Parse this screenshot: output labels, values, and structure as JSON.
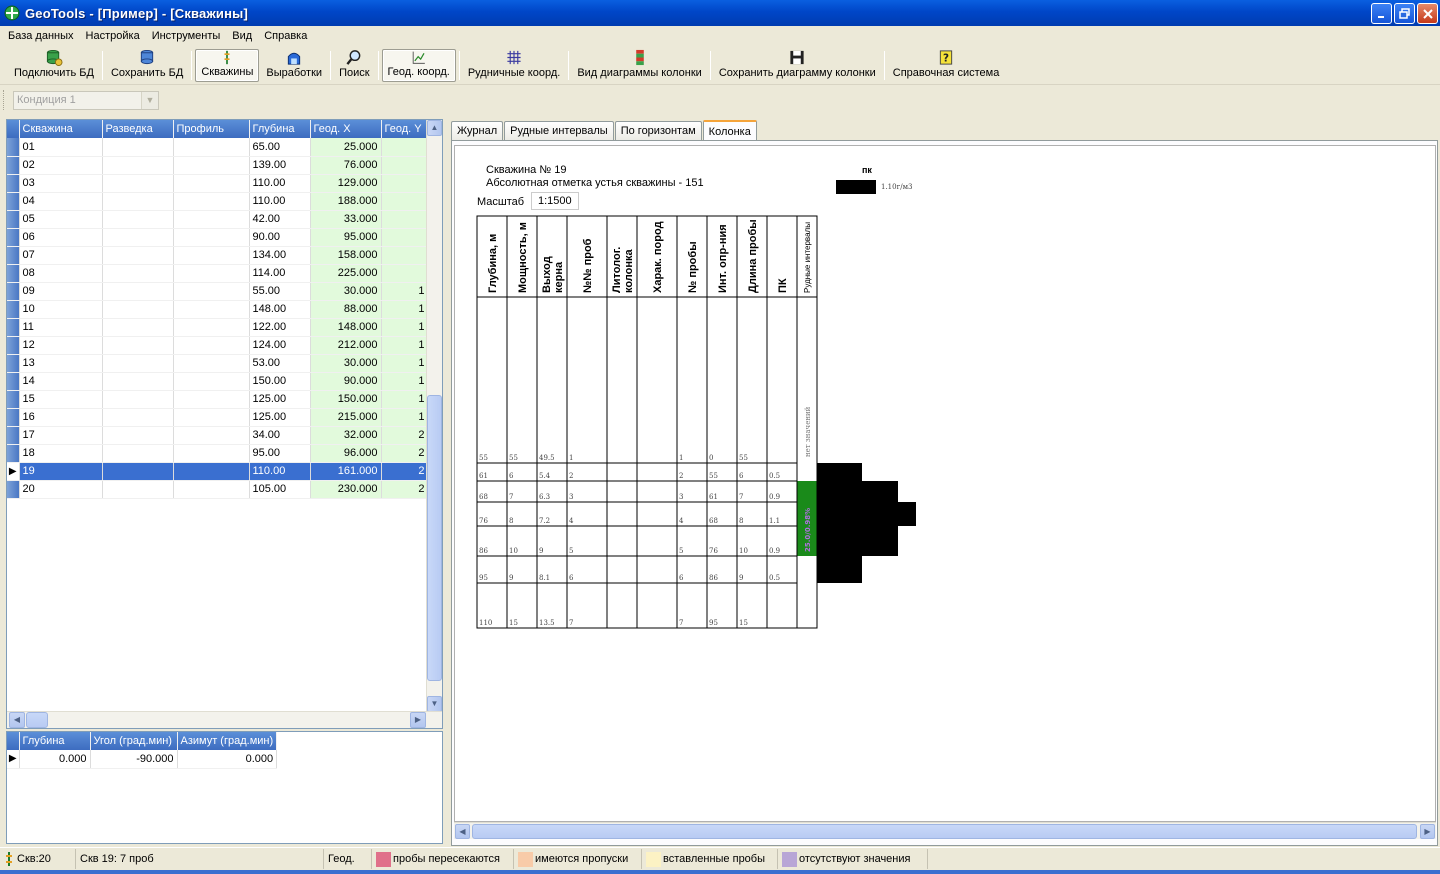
{
  "window": {
    "title": "GeoTools - [Пример] - [Скважины]"
  },
  "menu": [
    {
      "label": "База данных"
    },
    {
      "label": "Настройка"
    },
    {
      "label": "Инструменты"
    },
    {
      "label": "Вид"
    },
    {
      "label": "Справка"
    }
  ],
  "toolbar": {
    "connect_db": "Подключить БД",
    "save_db": "Сохранить БД",
    "wells": "Скважины",
    "workings": "Выработки",
    "search": "Поиск",
    "geod_coords": "Геод. коорд.",
    "mine_coords": "Рудничные коорд.",
    "column_view": "Вид диаграммы колонки",
    "save_column": "Сохранить диаграмму колонки",
    "help": "Справочная система"
  },
  "condition": {
    "value": "Кондиция 1"
  },
  "wells_table": {
    "columns": [
      "Скважина",
      "Разведка",
      "Профиль",
      "Глубина",
      "Геод. X",
      "Геод. Y"
    ],
    "rows": [
      {
        "well": "01",
        "depth": "65.00",
        "x": "25.000",
        "y": ""
      },
      {
        "well": "02",
        "depth": "139.00",
        "x": "76.000",
        "y": ""
      },
      {
        "well": "03",
        "depth": "110.00",
        "x": "129.000",
        "y": ""
      },
      {
        "well": "04",
        "depth": "110.00",
        "x": "188.000",
        "y": ""
      },
      {
        "well": "05",
        "depth": "42.00",
        "x": "33.000",
        "y": ""
      },
      {
        "well": "06",
        "depth": "90.00",
        "x": "95.000",
        "y": ""
      },
      {
        "well": "07",
        "depth": "134.00",
        "x": "158.000",
        "y": ""
      },
      {
        "well": "08",
        "depth": "114.00",
        "x": "225.000",
        "y": ""
      },
      {
        "well": "09",
        "depth": "55.00",
        "x": "30.000",
        "y": "1"
      },
      {
        "well": "10",
        "depth": "148.00",
        "x": "88.000",
        "y": "1"
      },
      {
        "well": "11",
        "depth": "122.00",
        "x": "148.000",
        "y": "1"
      },
      {
        "well": "12",
        "depth": "124.00",
        "x": "212.000",
        "y": "1"
      },
      {
        "well": "13",
        "depth": "53.00",
        "x": "30.000",
        "y": "1"
      },
      {
        "well": "14",
        "depth": "150.00",
        "x": "90.000",
        "y": "1"
      },
      {
        "well": "15",
        "depth": "125.00",
        "x": "150.000",
        "y": "1"
      },
      {
        "well": "16",
        "depth": "125.00",
        "x": "215.000",
        "y": "1"
      },
      {
        "well": "17",
        "depth": "34.00",
        "x": "32.000",
        "y": "2"
      },
      {
        "well": "18",
        "depth": "95.00",
        "x": "96.000",
        "y": "2"
      },
      {
        "well": "19",
        "depth": "110.00",
        "x": "161.000",
        "y": "2",
        "selected": true
      },
      {
        "well": "20",
        "depth": "105.00",
        "x": "230.000",
        "y": "2"
      }
    ]
  },
  "incl_table": {
    "columns": [
      "Глубина",
      "Угол (град.мин)",
      "Азимут (град.мин)"
    ],
    "rows": [
      {
        "depth": "0.000",
        "angle": "-90.000",
        "azimuth": "0.000"
      }
    ]
  },
  "tabs": [
    {
      "label": "Журнал"
    },
    {
      "label": "Рудные интервалы"
    },
    {
      "label": "По горизонтам"
    },
    {
      "label": "Колонка",
      "active": true
    }
  ],
  "column": {
    "well_title": "Скважина № 19",
    "elevation": "Абсолютная отметка устья скважины - 151",
    "scale_label": "Масштаб",
    "scale_value": "1:1500",
    "legend_title": "пк",
    "legend_unit": "1.10г/м3",
    "headers": [
      "Глубина, м",
      "Мощность, м",
      "Выход\nкерна",
      "№№ проб",
      "Литолог.\nколонка",
      "Харак. пород",
      "№ пробы",
      "Инт. опр-ния",
      "Длина пробы",
      "ПК"
    ],
    "ore_header": "Рудные интервалы",
    "no_values": "нет значений",
    "ore_label": "25.0/0.98%",
    "rows": [
      {
        "depth": "55",
        "power": "55",
        "core": "49.5",
        "nn": "1",
        "sample": "1",
        "interval": "0",
        "length": "55",
        "pk": "",
        "pk_value": 0
      },
      {
        "depth": "61",
        "power": "6",
        "core": "5.4",
        "nn": "2",
        "sample": "2",
        "interval": "55",
        "length": "6",
        "pk": "0.5",
        "pk_value": 0.5
      },
      {
        "depth": "68",
        "power": "7",
        "core": "6.3",
        "nn": "3",
        "sample": "3",
        "interval": "61",
        "length": "7",
        "pk": "0.9",
        "pk_value": 0.9
      },
      {
        "depth": "76",
        "power": "8",
        "core": "7.2",
        "nn": "4",
        "sample": "4",
        "interval": "68",
        "length": "8",
        "pk": "1.1",
        "pk_value": 1.1
      },
      {
        "depth": "86",
        "power": "10",
        "core": "9",
        "nn": "5",
        "sample": "5",
        "interval": "76",
        "length": "10",
        "pk": "0.9",
        "pk_value": 0.9
      },
      {
        "depth": "95",
        "power": "9",
        "core": "8.1",
        "nn": "6",
        "sample": "6",
        "interval": "86",
        "length": "9",
        "pk": "0.5",
        "pk_value": 0.5
      },
      {
        "depth": "110",
        "power": "15",
        "core": "13.5",
        "nn": "7",
        "sample": "7",
        "interval": "95",
        "length": "15",
        "pk": "",
        "pk_value": 0
      }
    ]
  },
  "status": {
    "wells": "Скв:20",
    "current": "Скв 19: 7 проб",
    "mode": "Геод.",
    "legend": [
      {
        "label": "пробы пересекаются",
        "color": "#e0708a"
      },
      {
        "label": "имеются пропуски",
        "color": "#f8cba8"
      },
      {
        "label": "вставленные пробы",
        "color": "#fcf2c4"
      },
      {
        "label": "отсутствуют значения",
        "color": "#b8a6d6"
      }
    ]
  },
  "colors": {
    "ore_interval": "#1a8a1a",
    "pk_bar": "#000000",
    "selection": "#3a6fd0",
    "geod_cell": "#e2fadc"
  }
}
